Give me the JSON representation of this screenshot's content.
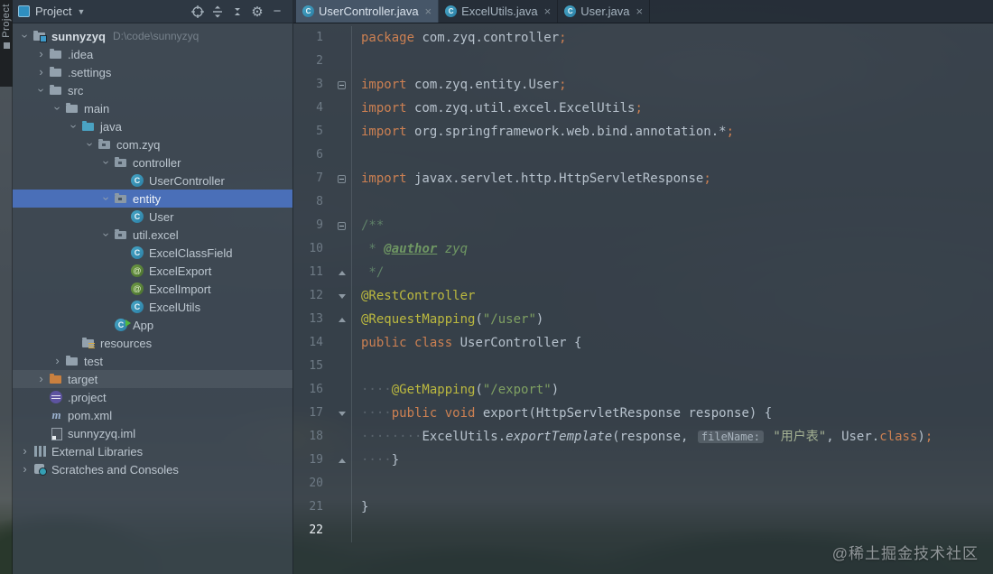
{
  "theme": {
    "selection_blue": "#4a6fb8",
    "keyword_orange": "#cc8052",
    "annotation_yellow": "#bcb93f",
    "string_green": "#7fa062",
    "panel_bg": "#38424c",
    "tab_active_bg": "#48596a"
  },
  "toolwindow_strip": {
    "label": "Project"
  },
  "project_panel": {
    "header": {
      "title": "Project",
      "toolbar_icons": [
        "locate-icon",
        "expand-all-icon",
        "collapse-all-icon",
        "settings-gear-icon",
        "hide-panel-icon"
      ]
    },
    "tree": [
      {
        "indent": 0,
        "chevron": "expanded",
        "icon": "project-root",
        "label": "sunnyzyq",
        "bold": true,
        "path": "D:\\code\\sunnyzyq"
      },
      {
        "indent": 1,
        "chevron": "collapsed",
        "icon": "folder",
        "label": ".idea"
      },
      {
        "indent": 1,
        "chevron": "collapsed",
        "icon": "folder",
        "label": ".settings"
      },
      {
        "indent": 1,
        "chevron": "expanded",
        "icon": "folder",
        "label": "src"
      },
      {
        "indent": 2,
        "chevron": "expanded",
        "icon": "folder",
        "label": "main"
      },
      {
        "indent": 3,
        "chevron": "expanded",
        "icon": "folder-java",
        "label": "java"
      },
      {
        "indent": 4,
        "chevron": "expanded",
        "icon": "package",
        "label": "com.zyq"
      },
      {
        "indent": 5,
        "chevron": "expanded",
        "icon": "package",
        "label": "controller"
      },
      {
        "indent": 6,
        "chevron": "",
        "icon": "class",
        "label": "UserController"
      },
      {
        "indent": 5,
        "chevron": "expanded",
        "icon": "package",
        "label": "entity",
        "selected": true
      },
      {
        "indent": 6,
        "chevron": "",
        "icon": "class",
        "label": "User"
      },
      {
        "indent": 5,
        "chevron": "expanded",
        "icon": "package",
        "label": "util.excel"
      },
      {
        "indent": 6,
        "chevron": "",
        "icon": "class",
        "label": "ExcelClassField"
      },
      {
        "indent": 6,
        "chevron": "",
        "icon": "annotation",
        "label": "ExcelExport"
      },
      {
        "indent": 6,
        "chevron": "",
        "icon": "annotation",
        "label": "ExcelImport"
      },
      {
        "indent": 6,
        "chevron": "",
        "icon": "class",
        "label": "ExcelUtils"
      },
      {
        "indent": 5,
        "chevron": "",
        "icon": "class-run",
        "label": "App"
      },
      {
        "indent": 3,
        "chevron": "",
        "icon": "folder-resources",
        "label": "resources"
      },
      {
        "indent": 2,
        "chevron": "collapsed",
        "icon": "folder",
        "label": "test"
      },
      {
        "indent": 1,
        "chevron": "collapsed",
        "icon": "folder-target",
        "label": "target",
        "hover": true
      },
      {
        "indent": 1,
        "chevron": "",
        "icon": "eclipse",
        "label": ".project"
      },
      {
        "indent": 1,
        "chevron": "",
        "icon": "maven",
        "label": "pom.xml"
      },
      {
        "indent": 1,
        "chevron": "",
        "icon": "iml",
        "label": "sunnyzyq.iml"
      },
      {
        "indent": 0,
        "chevron": "collapsed",
        "icon": "libs",
        "label": "External Libraries"
      },
      {
        "indent": 0,
        "chevron": "collapsed",
        "icon": "scratch",
        "label": "Scratches and Consoles"
      }
    ]
  },
  "editor": {
    "tabs": [
      {
        "label": "UserController.java",
        "active": true,
        "close": "×"
      },
      {
        "label": "ExcelUtils.java",
        "active": false,
        "close": "×"
      },
      {
        "label": "User.java",
        "active": false,
        "close": "×"
      }
    ],
    "lines": [
      {
        "num": 1,
        "fold": "",
        "segments": [
          [
            "kw",
            "package"
          ],
          [
            "pl",
            " com.zyq.controller"
          ],
          [
            "kw",
            ";"
          ]
        ]
      },
      {
        "num": 2,
        "fold": "",
        "segments": []
      },
      {
        "num": 3,
        "fold": "minus",
        "segments": [
          [
            "kw",
            "import"
          ],
          [
            "pl",
            " com.zyq.entity.User"
          ],
          [
            "kw",
            ";"
          ]
        ]
      },
      {
        "num": 4,
        "fold": "",
        "segments": [
          [
            "kw",
            "import"
          ],
          [
            "pl",
            " com.zyq.util.excel.ExcelUtils"
          ],
          [
            "kw",
            ";"
          ]
        ]
      },
      {
        "num": 5,
        "fold": "",
        "segments": [
          [
            "kw",
            "import"
          ],
          [
            "pl",
            " org.springframework.web.bind.annotation.*"
          ],
          [
            "kw",
            ";"
          ]
        ]
      },
      {
        "num": 6,
        "fold": "",
        "segments": []
      },
      {
        "num": 7,
        "fold": "minus",
        "segments": [
          [
            "kw",
            "import"
          ],
          [
            "pl",
            " javax.servlet.http.HttpServletResponse"
          ],
          [
            "kw",
            ";"
          ]
        ]
      },
      {
        "num": 8,
        "fold": "",
        "segments": []
      },
      {
        "num": 9,
        "fold": "minus",
        "segments": [
          [
            "doc",
            "/**"
          ]
        ]
      },
      {
        "num": 10,
        "fold": "",
        "segments": [
          [
            "doc",
            " * "
          ],
          [
            "doctag",
            "@author"
          ],
          [
            "docval",
            " zyq"
          ]
        ]
      },
      {
        "num": 11,
        "fold": "up",
        "segments": [
          [
            "doc",
            " */"
          ]
        ]
      },
      {
        "num": 12,
        "fold": "down",
        "segments": [
          [
            "ann",
            "@RestController"
          ]
        ]
      },
      {
        "num": 13,
        "fold": "up",
        "segments": [
          [
            "ann",
            "@RequestMapping"
          ],
          [
            "pl",
            "("
          ],
          [
            "str",
            "\"/user\""
          ],
          [
            "pl",
            ")"
          ]
        ]
      },
      {
        "num": 14,
        "fold": "",
        "segments": [
          [
            "kw",
            "public class"
          ],
          [
            "pl",
            " UserController {"
          ]
        ]
      },
      {
        "num": 15,
        "fold": "",
        "segments": []
      },
      {
        "num": 16,
        "fold": "",
        "segments": [
          [
            "ws",
            "····"
          ],
          [
            "ann",
            "@GetMapping"
          ],
          [
            "pl",
            "("
          ],
          [
            "str",
            "\"/export\""
          ],
          [
            "pl",
            ")"
          ]
        ]
      },
      {
        "num": 17,
        "fold": "down",
        "segments": [
          [
            "ws",
            "····"
          ],
          [
            "kw",
            "public void"
          ],
          [
            "pl",
            " export(HttpServletResponse response) {"
          ]
        ]
      },
      {
        "num": 18,
        "fold": "",
        "segments": [
          [
            "ws",
            "········"
          ],
          [
            "pl",
            "ExcelUtils."
          ],
          [
            "pl it",
            "exportTemplate"
          ],
          [
            "pl",
            "(response, "
          ],
          [
            "hint",
            "fileName:"
          ],
          [
            "pl",
            " "
          ],
          [
            "str2",
            "\"用户表\""
          ],
          [
            "pl",
            ", User."
          ],
          [
            "kw",
            "class"
          ],
          [
            "pl",
            ")"
          ],
          [
            "kw",
            ";"
          ]
        ]
      },
      {
        "num": 19,
        "fold": "up",
        "segments": [
          [
            "ws",
            "····"
          ],
          [
            "pl",
            "}"
          ]
        ]
      },
      {
        "num": 20,
        "fold": "",
        "segments": []
      },
      {
        "num": 21,
        "fold": "",
        "segments": [
          [
            "pl",
            "}"
          ]
        ]
      },
      {
        "num": 22,
        "fold": "",
        "active": true,
        "segments": []
      }
    ]
  },
  "watermark": "@稀土掘金技术社区"
}
